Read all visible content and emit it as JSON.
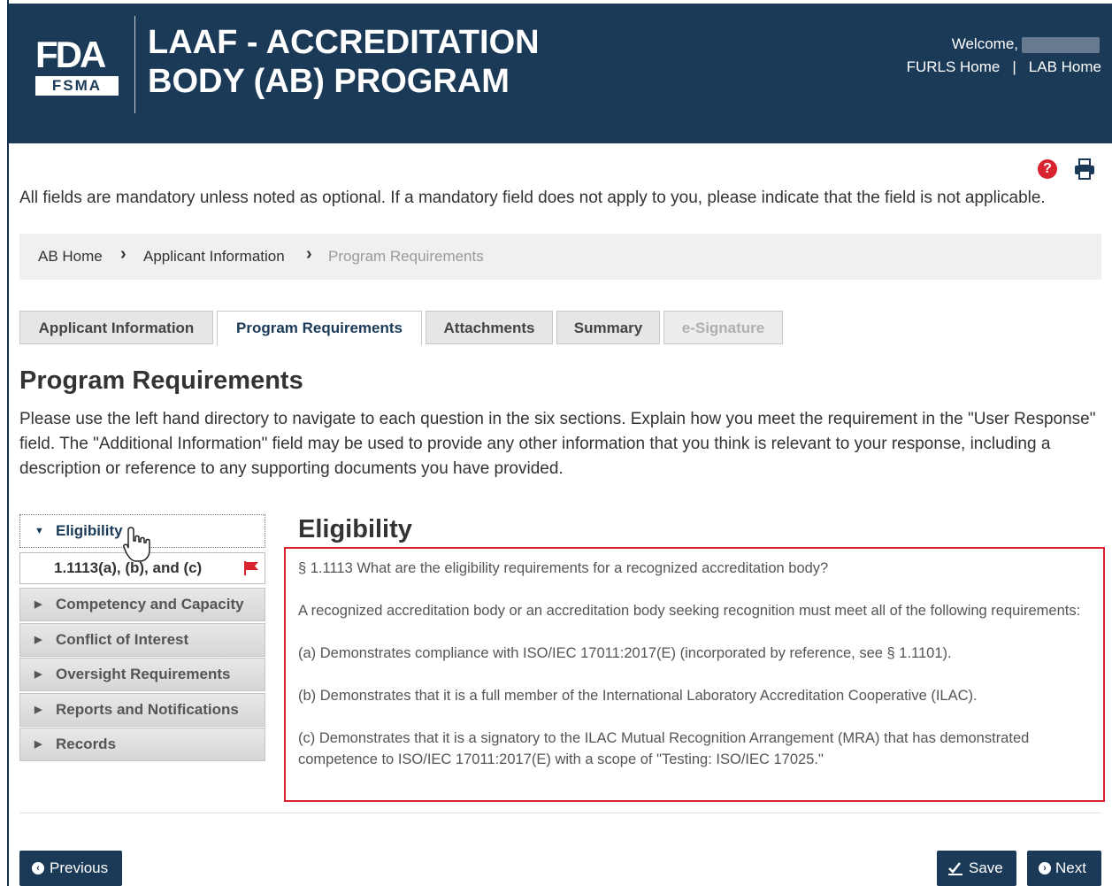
{
  "header": {
    "logo_top": "FDA",
    "logo_bottom": "FSMA",
    "title_line1": "LAAF - ACCREDITATION",
    "title_line2": "BODY (AB) PROGRAM",
    "welcome": "Welcome,",
    "links": [
      "FURLS Home",
      "LAB Home"
    ]
  },
  "instructions": "All fields are mandatory unless noted as optional. If a mandatory field does not apply to you, please indicate that the field is not applicable.",
  "breadcrumb": [
    "AB Home",
    "Applicant Information",
    "Program Requirements"
  ],
  "tabs": [
    {
      "label": "Applicant Information",
      "state": "normal"
    },
    {
      "label": "Program Requirements",
      "state": "active"
    },
    {
      "label": "Attachments",
      "state": "normal"
    },
    {
      "label": "Summary",
      "state": "normal"
    },
    {
      "label": "e-Signature",
      "state": "disabled"
    }
  ],
  "page_title": "Program Requirements",
  "page_description": "Please use the left hand directory to navigate to each question in the six sections. Explain how you meet the requirement in the \"User Response\" field. The \"Additional Information\" field may be used to provide any other information that you think is relevant to your response, including a description or reference to any supporting documents you have provided.",
  "leftnav": {
    "open_section": "Eligibility",
    "open_sub": "1.1113(a), (b), and (c)",
    "sections": [
      "Competency and Capacity",
      "Conflict of Interest",
      "Oversight Requirements",
      "Reports and Notifications",
      "Records"
    ]
  },
  "content": {
    "section_title": "Eligibility",
    "paragraphs": [
      "§ 1.1113 What are the eligibility requirements for a recognized accreditation body?",
      "A recognized accreditation body or an accreditation body seeking recognition must meet all of the following requirements:",
      "(a) Demonstrates compliance with ISO/IEC 17011:2017(E) (incorporated by reference, see § 1.1101).",
      "(b) Demonstrates that it is a full member of the International Laboratory Accreditation Cooperative (ILAC).",
      "(c) Demonstrates that it is a signatory to the ILAC Mutual Recognition Arrangement (MRA) that has demonstrated competence to ISO/IEC 17011:2017(E) with a scope of \"Testing: ISO/IEC 17025.\""
    ]
  },
  "buttons": {
    "previous": "Previous",
    "save": "Save",
    "next": "Next"
  },
  "colors": {
    "header_bg": "#1b3a57",
    "accent_red": "#d9232e",
    "button_bg": "#1b3a57"
  }
}
